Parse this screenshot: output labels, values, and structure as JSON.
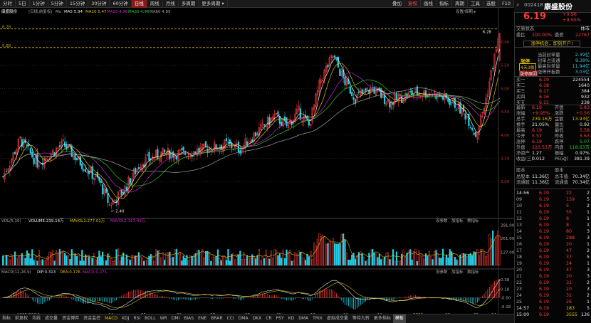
{
  "toolbar": {
    "items": [
      "分时",
      "5日",
      "1分钟",
      "5分钟",
      "15分钟",
      "30分钟",
      "60分钟",
      "日线",
      "周线",
      "月线",
      "多周期",
      "更多周期 ▾"
    ],
    "active_index": 7,
    "right_items": [
      "叠加",
      "复权",
      "画线",
      "指标",
      "周期",
      "工具"
    ],
    "right_items2": [
      "选股",
      "F10"
    ],
    "note": "设置/周期 ▸"
  },
  "stock": {
    "code": "002418",
    "name": "康盛股份",
    "price": "6.19",
    "change": "+0.56",
    "change_pct": "+9.95%"
  },
  "chart_header": {
    "name": "康盛股份",
    "desc": "(日线,前复权)",
    "ma5": "MA5 5.94",
    "ma10": "MA10 5.47",
    "ma20": "MA20 4.96",
    "ma30": "MA30 4.96",
    "ma60": "MA60 4.89",
    "ma_extra": "Mo"
  },
  "price_axis": {
    "labels": [
      "6.00",
      "5.50",
      "5.00",
      "4.50",
      "4.00",
      "3.50",
      "3.00"
    ]
  },
  "price_lines": {
    "top_label": "6.28",
    "mid_label": "5.88"
  },
  "annotations": {
    "high_label": "6.28",
    "low_label": "2.40"
  },
  "vol_header": {
    "name": "VOL(5,10)",
    "vol": "VOLUME:239.16万",
    "mavol1": "MAVOL1:277.01万",
    "mavol2": "MAVOL2:167.41万"
  },
  "vol_axis": {
    "labels": [
      "391.00",
      "261.00",
      "127.00"
    ]
  },
  "vol_buttons": [
    "设参数",
    "加指标",
    "换指标"
  ],
  "macd_header": {
    "name": "MACD(12,26,9)",
    "dif": "DIF:0.313",
    "dea": "DEA:0.176",
    "macd": "MACD:0.275"
  },
  "macd_axis": {
    "labels": [
      "0.38",
      "0.18",
      "-0.00",
      "-0.18"
    ]
  },
  "macd_buttons": [
    "设参数",
    "加指标",
    "换指标"
  ],
  "time_axis": {
    "labels": [
      "2025/02/10",
      "04",
      "05",
      "06",
      "07",
      "08",
      "09",
      "10",
      "11",
      "12",
      "2026",
      "02",
      "03",
      "04"
    ]
  },
  "bottom_tabs": {
    "items": [
      "指标",
      "前复权",
      "均线",
      "成交量",
      "资金博弈",
      "资金监控",
      "MACD",
      "KDJ",
      "RSI",
      "BOLL",
      "WR",
      "DMI",
      "BIAS",
      "ENE",
      "BRAR",
      "CCI",
      "DMA",
      "DKX",
      "CR",
      "PSY",
      "KD",
      "DMA",
      "TRIX",
      "虚拟成交量",
      "等待九转",
      "更多指标",
      "模板"
    ],
    "highlight_index": 6
  },
  "sidebar": {
    "status_label": "交易状态",
    "status_value": "休市",
    "wei_bi": "委比",
    "wei_bi_val": "100.00%",
    "wei_cha": "委差",
    "wei_cha_val": "22767",
    "alert_text": "涨停机会，即刻开户!",
    "limit": [
      {
        "k": "当前封单量",
        "v": "2.39亿"
      },
      {
        "k": "封单占流通",
        "v": "9.39%"
      },
      {
        "k": "最高封单量",
        "v": "11.94亿"
      },
      {
        "k": "涨停开板数",
        "v": "3.03亿"
      }
    ],
    "badge1": "涨停",
    "badge2": "4天3板",
    "badge3": "涨停原因",
    "sell": [
      {
        "n": "卖五",
        "p": "",
        "v": ""
      },
      {
        "n": "卖四",
        "p": "",
        "v": ""
      },
      {
        "n": "卖三",
        "p": "",
        "v": ""
      },
      {
        "n": "卖二",
        "p": "",
        "v": ""
      },
      {
        "n": "卖一",
        "p": "",
        "v": ""
      }
    ],
    "buy": [
      {
        "n": "买一",
        "p": "6.19",
        "v": "224554"
      },
      {
        "n": "买二",
        "p": "6.18",
        "v": "1640"
      },
      {
        "n": "买三",
        "p": "6.17",
        "v": "384"
      },
      {
        "n": "买四",
        "p": "6.16",
        "v": "932"
      },
      {
        "n": "买五",
        "p": "6.15",
        "v": "238"
      }
    ],
    "quote": [
      {
        "k1": "最新",
        "v1": "6.19",
        "k2": "开盘",
        "v2": "5.83"
      },
      {
        "k1": "涨幅",
        "v1": "+9.95%",
        "k2": "涨跌",
        "v2": "+0.56"
      },
      {
        "k1": "总手",
        "v1": "239.16万",
        "k2": "金额",
        "v2": "13.93亿"
      },
      {
        "k1": "换手",
        "v1": "21.05%",
        "k2": "量比",
        "v2": "0.92"
      },
      {
        "k1": "最高",
        "v1": "6.19",
        "k2": "最低",
        "v2": "5.58"
      },
      {
        "k1": "今开",
        "v1": "5.57",
        "k2": "昨收",
        "v2": "5.63"
      },
      {
        "k1": "涨停",
        "v1": "6.19",
        "k2": "跌停",
        "v2": "5.07"
      },
      {
        "k1": "外盘",
        "v1": "120.53万",
        "k2": "内盘",
        "v2": "118.63万"
      },
      {
        "k1": "净资产",
        "v1": "1.27",
        "k2": "振幅",
        "v2": "0.97%"
      },
      {
        "k1": "收益(三)",
        "v1": "0.012",
        "k2": "PE(动)",
        "v2": "381.39"
      }
    ],
    "cap_header": "股本",
    "cap": [
      {
        "k": "总股本",
        "v": "11.36亿",
        "k2": "总市值",
        "v2": "70.34亿"
      },
      {
        "k": "流通股",
        "v": "11.36亿",
        "k2": "流通值",
        "v2": "70.34亿"
      }
    ],
    "ticks": [
      {
        "t": "14:56",
        "p": "6.19",
        "v": "22",
        "n": "2"
      },
      {
        "t": "",
        "p": "6.19",
        "v": "139",
        "n": "5"
      },
      {
        "t": "",
        "p": "6.19",
        "v": "5",
        "n": "2"
      },
      {
        "t": "",
        "p": "6.19",
        "v": "55",
        "n": "1"
      },
      {
        "t": "",
        "p": "6.19",
        "v": "6",
        "n": "1"
      },
      {
        "t": "",
        "p": "6.19",
        "v": "8",
        "n": "1"
      },
      {
        "t": "",
        "p": "6.19",
        "v": "80",
        "n": "3"
      },
      {
        "t": "",
        "p": "6.19",
        "v": "288",
        "n": "3"
      },
      {
        "t": "",
        "p": "6.19",
        "v": "20",
        "n": "1"
      },
      {
        "t": "",
        "p": "6.19",
        "v": "47",
        "n": "2"
      },
      {
        "t": "",
        "p": "6.19",
        "v": "37",
        "n": "5"
      },
      {
        "t": "",
        "p": "6.19",
        "v": "24",
        "n": "1"
      },
      {
        "t": "",
        "p": "6.19",
        "v": "47",
        "n": "3"
      },
      {
        "t": "",
        "p": "6.19",
        "v": "20",
        "n": "3"
      },
      {
        "t": "",
        "p": "6.19",
        "v": "31",
        "n": "2"
      },
      {
        "t": "",
        "p": "6.19",
        "v": "20",
        "n": "3"
      },
      {
        "t": "",
        "p": "6.19",
        "v": "31",
        "n": "2"
      },
      {
        "t": "",
        "p": "6.19",
        "v": "26",
        "n": "1"
      },
      {
        "t": "14:57",
        "p": "6.19",
        "v": "183",
        "n": "5"
      },
      {
        "t": "15:00",
        "p": "6.19",
        "v": "3555",
        "n": "136"
      }
    ],
    "tick_times": [
      "14:56",
      "09",
      "10",
      "11",
      "12",
      "13",
      "14",
      "15",
      "16",
      "17",
      "18",
      "19",
      "20",
      "21",
      "22",
      "23",
      "24",
      "25",
      "14:57",
      "15:00"
    ]
  },
  "colors": {
    "up": "#ff3b3b",
    "down": "#20d0e8",
    "ma5": "#e8e8e8",
    "ma10": "#e0c000",
    "ma20": "#d020d0",
    "ma30": "#20d020",
    "ma60": "#a0a0a0"
  }
}
